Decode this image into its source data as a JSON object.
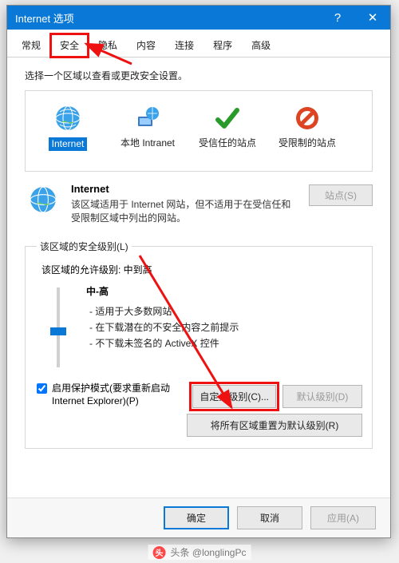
{
  "window": {
    "title": "Internet 选项",
    "help_glyph": "?",
    "close_glyph": "✕"
  },
  "tabs": {
    "general": "常规",
    "security": "安全",
    "privacy": "隐私",
    "content": "内容",
    "connections": "连接",
    "programs": "程序",
    "advanced": "高级"
  },
  "instruction": "选择一个区域以查看或更改安全设置。",
  "zones": {
    "internet": "Internet",
    "intranet": "本地 Intranet",
    "trusted": "受信任的站点",
    "restricted": "受限制的站点"
  },
  "zone_detail": {
    "name": "Internet",
    "desc": "该区域适用于 Internet 网站，但不适用于在受信任和受限制区域中列出的网站。",
    "sites_btn": "站点(S)"
  },
  "levelbox": {
    "legend": "该区域的安全级别(L)",
    "allow_label": "该区域的允许级别: 中到高",
    "level_name": "中-高",
    "bullets": [
      "适用于大多数网站",
      "在下载潜在的不安全内容之前提示",
      "不下载未签名的 ActiveX 控件"
    ],
    "protected_mode": "启用保护模式(要求重新启动 Internet Explorer)(P)",
    "custom_btn": "自定义级别(C)...",
    "default_btn": "默认级别(D)",
    "reset_btn": "将所有区域重置为默认级别(R)"
  },
  "dialog_buttons": {
    "ok": "确定",
    "cancel": "取消",
    "apply": "应用(A)"
  },
  "watermark": "头条 @longlingPc",
  "colors": {
    "accent": "#0a78d6",
    "highlight": "#e11"
  }
}
